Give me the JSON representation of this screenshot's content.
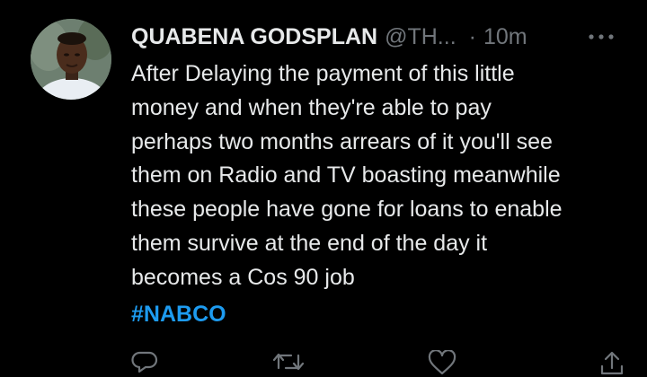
{
  "tweet": {
    "display_name": "QUABENA GODSPLAN",
    "handle": "@TH...",
    "separator": "·",
    "time": "10m",
    "body": "After Delaying the payment of this little\nmoney and when they're able to pay\nperhaps two months arrears of it you'll see\nthem on Radio and TV boasting meanwhile\nthese people have gone for loans to enable\nthem survive at the end of the day it\nbecomes a Cos 90 job",
    "hashtag": "#NABCO"
  },
  "actions": {
    "reply_icon": "reply-icon",
    "retweet_icon": "retweet-icon",
    "like_icon": "heart-icon",
    "share_icon": "share-icon"
  },
  "colors": {
    "background": "#000000",
    "text": "#e7e9ea",
    "muted": "#71767b",
    "link": "#1d9bf0"
  }
}
